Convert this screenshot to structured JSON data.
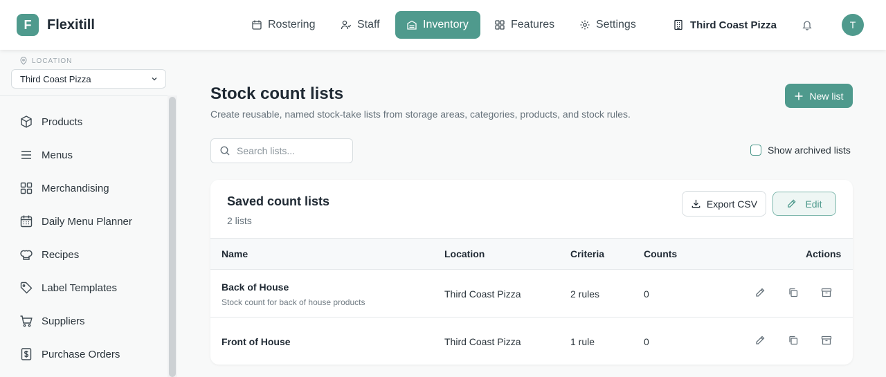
{
  "app": {
    "logo_letter": "F",
    "name": "Flexitill"
  },
  "nav": {
    "items": [
      {
        "label": "Rostering",
        "icon": "calendar-icon"
      },
      {
        "label": "Staff",
        "icon": "staff-icon"
      },
      {
        "label": "Inventory",
        "icon": "inventory-icon",
        "active": true
      },
      {
        "label": "Features",
        "icon": "grid-icon"
      },
      {
        "label": "Settings",
        "icon": "gear-icon"
      }
    ],
    "location": "Third Coast Pizza",
    "avatar_letter": "T"
  },
  "sidebar": {
    "location_label": "LOCATION",
    "location_value": "Third Coast Pizza",
    "items": [
      {
        "label": "Products",
        "icon": "box-icon"
      },
      {
        "label": "Menus",
        "icon": "menu-lines-icon"
      },
      {
        "label": "Merchandising",
        "icon": "grid-icon"
      },
      {
        "label": "Daily Menu Planner",
        "icon": "calendar-icon"
      },
      {
        "label": "Recipes",
        "icon": "chef-hat-icon"
      },
      {
        "label": "Label Templates",
        "icon": "tag-icon"
      },
      {
        "label": "Suppliers",
        "icon": "cart-icon"
      },
      {
        "label": "Purchase Orders",
        "icon": "receipt-icon"
      }
    ]
  },
  "main": {
    "title": "Stock count lists",
    "subtitle": "Create reusable, named stock-take lists from storage areas, categories, products, and stock rules.",
    "new_button": "New list",
    "search_placeholder": "Search lists...",
    "archived_label": "Show archived lists"
  },
  "card": {
    "title": "Saved count lists",
    "count": "2 lists",
    "export_label": "Export CSV",
    "edit_label": "Edit",
    "columns": [
      "Name",
      "Location",
      "Criteria",
      "Counts",
      "Actions"
    ],
    "rows": [
      {
        "name": "Back of House",
        "description": "Stock count for back of house products",
        "location": "Third Coast Pizza",
        "criteria": "2 rules",
        "counts": "0"
      },
      {
        "name": "Front of House",
        "description": "",
        "location": "Third Coast Pizza",
        "criteria": "1 rule",
        "counts": "0"
      }
    ]
  },
  "colors": {
    "accent": "#4f9a8d",
    "text": "#1f2933",
    "muted": "#66727b"
  }
}
